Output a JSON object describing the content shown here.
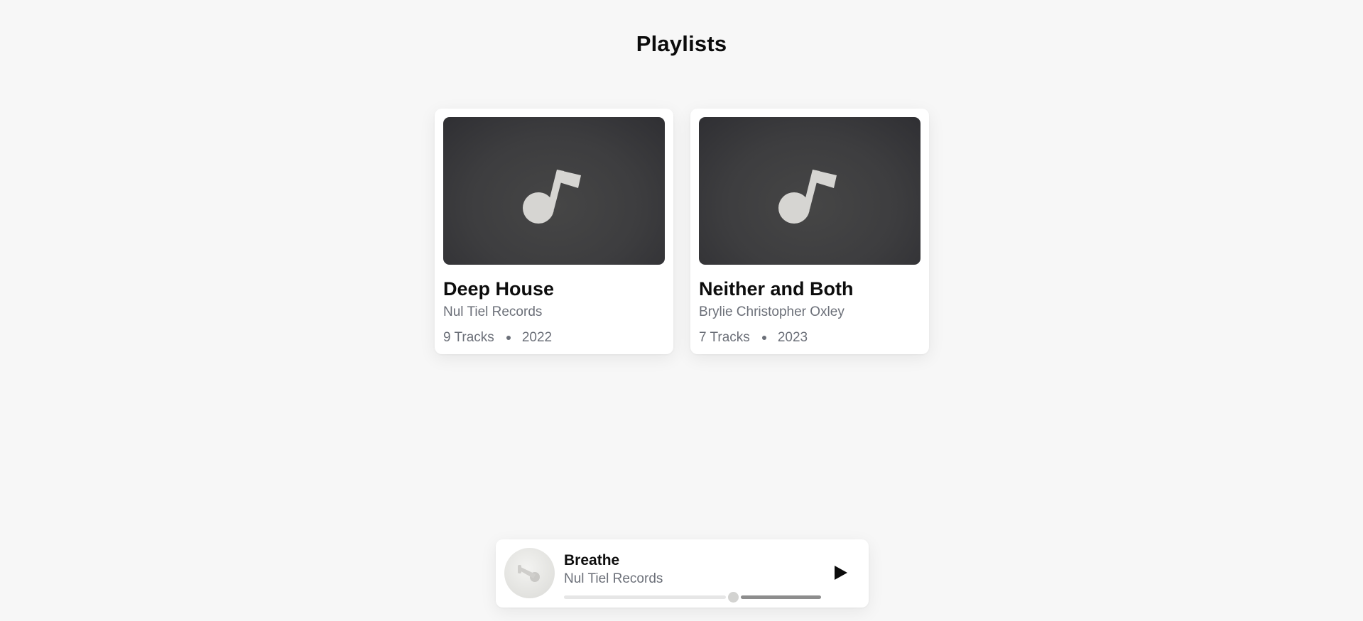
{
  "page": {
    "title": "Playlists"
  },
  "playlists": [
    {
      "title": "Deep House",
      "artist": "Nul Tiel Records",
      "tracks": "9 Tracks",
      "year": "2022",
      "cover_icon": "music-note-icon"
    },
    {
      "title": "Neither and Both",
      "artist": "Brylie Christopher Oxley",
      "tracks": "7 Tracks",
      "year": "2023",
      "cover_icon": "music-note-icon"
    }
  ],
  "player": {
    "title": "Breathe",
    "artist": "Nul Tiel Records",
    "progress": 0.66,
    "art_icon": "vinyl-disc-icon",
    "play_icon": "play-icon"
  },
  "colors": {
    "background": "#f7f7f7",
    "card": "#ffffff",
    "cover": "#3d3d3f",
    "note": "#d6d5d2",
    "muted_text": "#6b6f78",
    "progress_bar": "#8d8d8d"
  }
}
